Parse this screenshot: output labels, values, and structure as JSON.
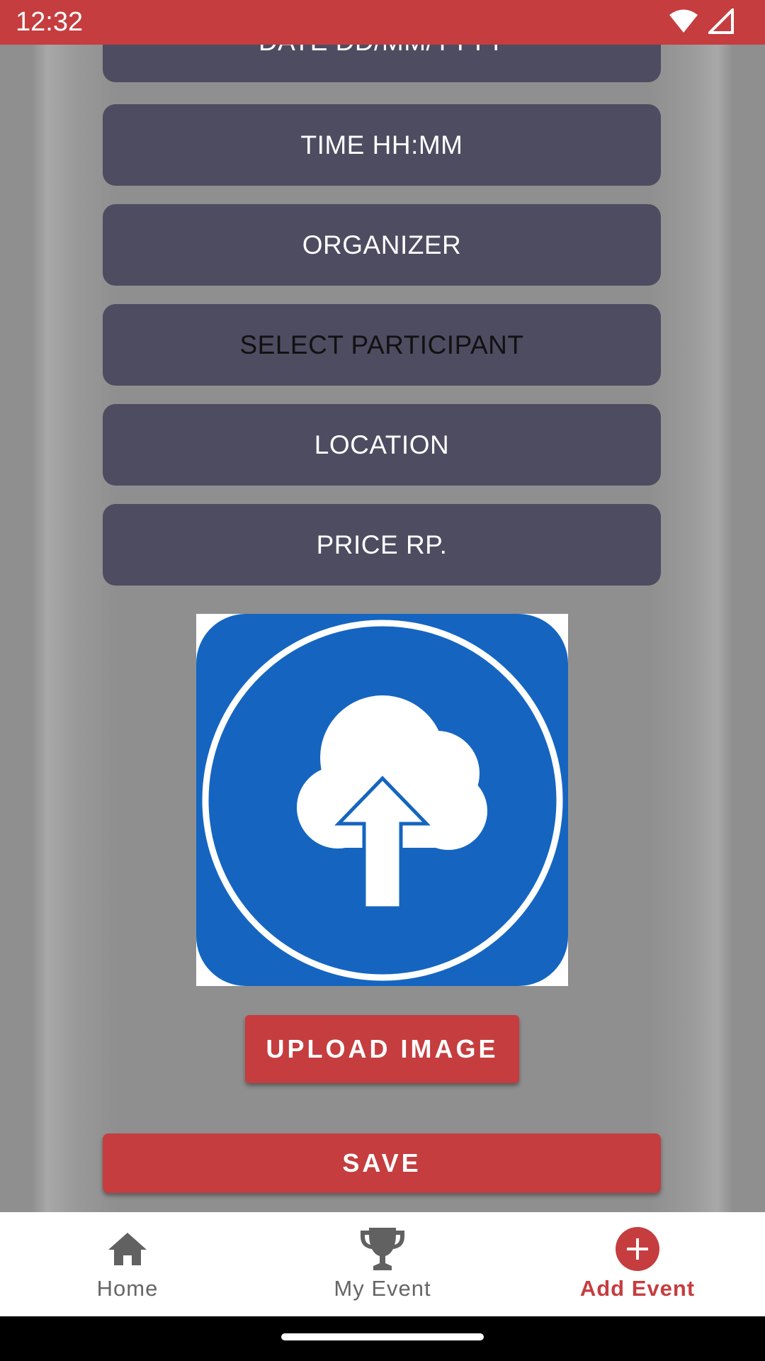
{
  "status_bar": {
    "time": "12:32",
    "icons": [
      "wifi-icon",
      "cell-signal-icon"
    ]
  },
  "form": {
    "fields": [
      {
        "label": "DATE DD/MM/YYYY"
      },
      {
        "label": "TIME HH:MM"
      },
      {
        "label": "ORGANIZER"
      },
      {
        "label": "SELECT PARTICIPANT"
      },
      {
        "label": "LOCATION"
      },
      {
        "label": "PRICE RP."
      }
    ],
    "upload_image_label": "UPLOAD IMAGE",
    "save_label": "SAVE",
    "upload_icon": "cloud-upload-icon"
  },
  "bottom_nav": {
    "items": [
      {
        "label": "Home",
        "icon": "home-icon",
        "active": false
      },
      {
        "label": "My Event",
        "icon": "trophy-icon",
        "active": false
      },
      {
        "label": "Add Event",
        "icon": "add-circle-icon",
        "active": true
      }
    ]
  },
  "colors": {
    "accent": "#c53d3f",
    "field_bg": "#4d4c61",
    "background": "#8f8f8f",
    "upload_blue": "#1565c0"
  }
}
